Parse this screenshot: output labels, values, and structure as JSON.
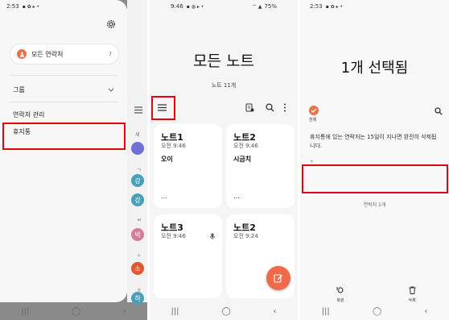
{
  "panel1": {
    "status_time": "2:53",
    "all_contacts_label": "모든 연락처",
    "all_contacts_count": "7",
    "groups_label": "그룹",
    "manage_contacts_label": "연락처 관리",
    "trash_label": "휴지통",
    "contact_avatars": [
      {
        "letter": "",
        "color": "#6f6fd6"
      },
      {
        "letter": "강",
        "color": "#4aa0b8"
      },
      {
        "letter": "강",
        "color": "#4aa0b8"
      },
      {
        "letter": "박",
        "color": "#d67b9a"
      },
      {
        "letter": "소",
        "color": "#e0582f"
      },
      {
        "letter": "하",
        "color": "#4aa0b8"
      }
    ],
    "index_letters": [
      "새",
      "ㄱ",
      "ㅂ",
      "ㅅ",
      "ㅎ"
    ]
  },
  "panel2": {
    "status_time": "9:46",
    "status_battery": "75%",
    "title": "모든 노트",
    "subtitle": "노트 11개",
    "notes": [
      {
        "title": "노트1",
        "time": "오전 9:46",
        "body": "오이",
        "footer": "..."
      },
      {
        "title": "노트2",
        "time": "오전 9:46",
        "body": "시금치",
        "footer": "..."
      },
      {
        "title": "노트3",
        "time": "오전 9:46",
        "body": "",
        "footer": ""
      },
      {
        "title": "노트2",
        "time": "오전 9:24",
        "body": "",
        "footer": ""
      }
    ]
  },
  "panel3": {
    "status_time": "2:53",
    "title": "1개 선택됨",
    "select_all_label": "전체",
    "trash_notice": "휴지통에 있는 연락처는 15일이 지나면 완전히 삭제됩니다.",
    "section_letter": "ㅎ",
    "contact_count": "연락처 1개",
    "restore_label": "복원",
    "delete_label": "삭제"
  },
  "colors": {
    "accent_orange": "#e8734a",
    "highlight_red": "#e60012",
    "fab": "#ef6a4a"
  }
}
